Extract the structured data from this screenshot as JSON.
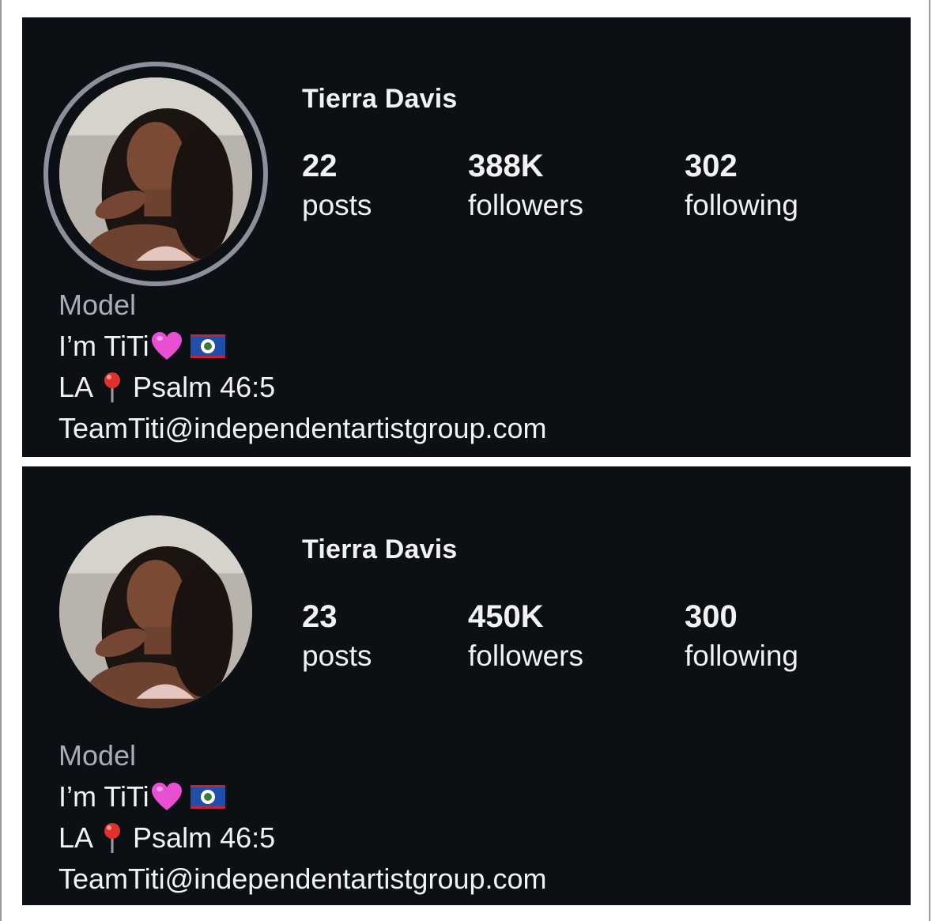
{
  "screenshots": [
    {
      "profile": {
        "name": "Tierra Davis",
        "stats": [
          {
            "value": "22",
            "label": "posts"
          },
          {
            "value": "388K",
            "label": "followers"
          },
          {
            "value": "302",
            "label": "following"
          }
        ],
        "bio": {
          "category": "Model",
          "line1": "I’m TiTi",
          "line2_a": "LA",
          "line2_b": "Psalm 46:5",
          "email": "TeamTiti@independentartistgroup.com"
        },
        "has_story_ring": true
      }
    },
    {
      "profile": {
        "name": "Tierra Davis",
        "stats": [
          {
            "value": "23",
            "label": "posts"
          },
          {
            "value": "450K",
            "label": "followers"
          },
          {
            "value": "300",
            "label": "following"
          }
        ],
        "bio": {
          "category": "Model",
          "line1": "I’m TiTi",
          "line2_a": "LA",
          "line2_b": "Psalm 46:5",
          "email": "TeamTiti@independentartistgroup.com"
        },
        "has_story_ring": false
      }
    }
  ],
  "icons": {
    "heart": "pink-heart-icon",
    "flag": "belize-flag-icon",
    "pin": "round-pushpin-icon"
  },
  "colors": {
    "background": "#0c0f14",
    "text": "#f2f2f2",
    "category": "#a8adb6",
    "story_ring": "#8b919c",
    "heart": "#e84fd2",
    "pin": "#e0312f"
  }
}
